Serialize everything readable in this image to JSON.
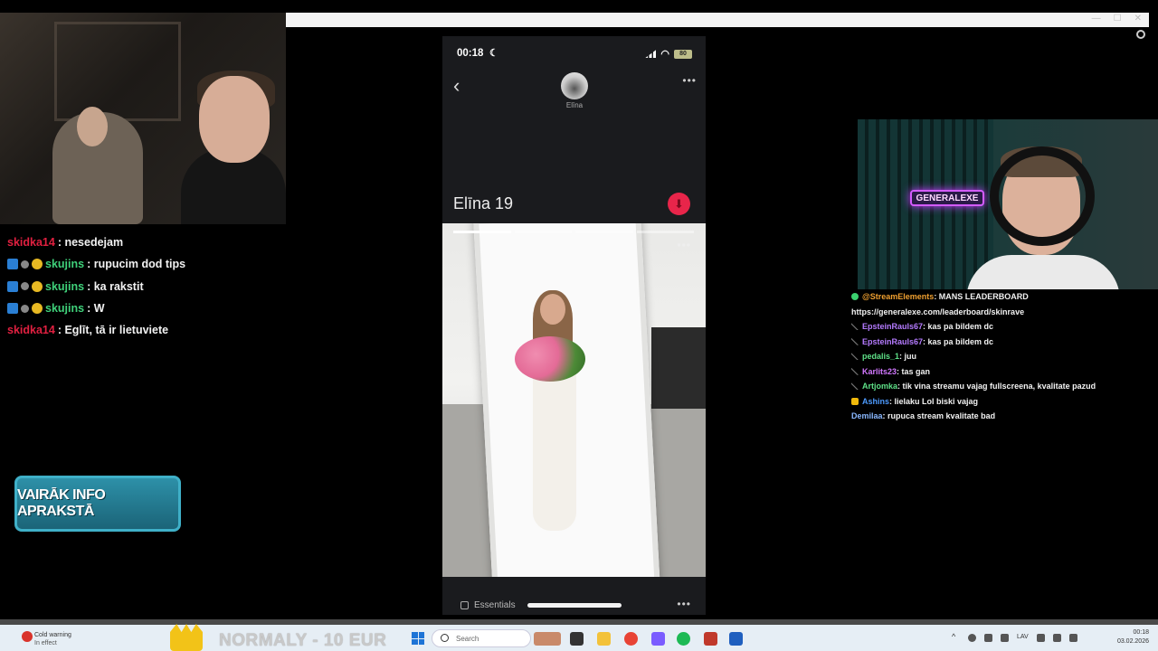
{
  "window": {
    "controls": [
      "—",
      "☐",
      "✕"
    ]
  },
  "chat_left": [
    {
      "user": "skidka14",
      "color": "#e02040",
      "badges": [],
      "msg": ": nesedejam"
    },
    {
      "user": "skujins",
      "color": "#3fd17a",
      "badges": [
        "prime",
        "mod",
        "coin"
      ],
      "msg": ": rupucim dod tips"
    },
    {
      "user": "skujins",
      "color": "#3fd17a",
      "badges": [
        "prime",
        "mod",
        "coin"
      ],
      "msg": ": ka rakstit"
    },
    {
      "user": "skujins",
      "color": "#3fd17a",
      "badges": [
        "prime",
        "mod",
        "coin"
      ],
      "msg": ": W"
    },
    {
      "user": "skidka14",
      "color": "#e02040",
      "badges": [],
      "msg": ": Eglīt, tā ir lietuviete"
    }
  ],
  "promo_button": {
    "label": "VAIRĀK INFO APRAKSTĀ"
  },
  "phone": {
    "time": "00:18",
    "battery": "80",
    "avatar_name": "Elīna",
    "profile_name": "Elīna 19",
    "essentials_label": "Essentials",
    "progress": {
      "total": 4,
      "current": 1
    }
  },
  "webcam_right": {
    "neon_sign": "GENERALEXE"
  },
  "chat_right": [
    {
      "icon": "green",
      "user": "@StreamElements",
      "color": "#f0a030",
      "msg": ": MANS LEADERBOARD",
      "wrap": false
    },
    {
      "icon": "",
      "user": "",
      "color": "#ffffff",
      "msg": "https://generalexe.com/leaderboard/skinrave",
      "wrap": false
    },
    {
      "icon": "sword",
      "user": "EpsteinRauls67",
      "color": "#b57bff",
      "msg": ": kas pa bildem dc",
      "wrap": false
    },
    {
      "icon": "sword",
      "user": "EpsteinRauls67",
      "color": "#b57bff",
      "msg": ": kas pa bildem dc",
      "wrap": false
    },
    {
      "icon": "sword",
      "user": "pedalis_1",
      "color": "#5ee087",
      "msg": ": juu",
      "wrap": false
    },
    {
      "icon": "sword",
      "user": "Karlits23",
      "color": "#d278ff",
      "msg": ": tas gan",
      "wrap": false
    },
    {
      "icon": "sword",
      "user": "Artjomka",
      "color": "#5ee087",
      "msg": ": tik vina streamu vajag fullscreena, kvalitate pazud",
      "wrap": false
    },
    {
      "icon": "bits",
      "user": "Ashins",
      "color": "#4d9bff",
      "msg": ": lielaku Lol biski vajag",
      "wrap": false
    },
    {
      "icon": "",
      "user": "Demilaa",
      "color": "#8ab8ff",
      "msg": ": rupuca stream kvalitate bad",
      "wrap": false
    }
  ],
  "taskbar": {
    "warning_title": "Cold warning",
    "warning_sub": "In effect",
    "promo_text": "NORMALY - 10 EUR",
    "search_placeholder": "Search",
    "language": "LAV",
    "clock_time": "00:18",
    "clock_date": "03.02.2026"
  }
}
